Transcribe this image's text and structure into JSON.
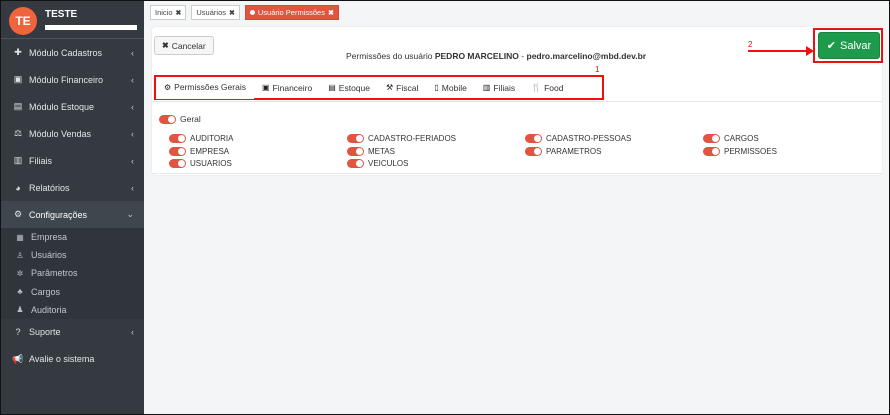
{
  "sidebar": {
    "avatar_initials": "TE",
    "user_name": "TESTE",
    "menu": [
      {
        "icon": "plus-icon",
        "glyph": "✚",
        "label": "Módulo Cadastros",
        "caret": "‹"
      },
      {
        "icon": "money-icon",
        "glyph": "▣",
        "label": "Módulo Financeiro",
        "caret": "‹"
      },
      {
        "icon": "archive-icon",
        "glyph": "▤",
        "label": "Módulo Estoque",
        "caret": "‹"
      },
      {
        "icon": "scale-icon",
        "glyph": "⚖",
        "label": "Módulo Vendas",
        "caret": "‹"
      },
      {
        "icon": "bar-chart-icon",
        "glyph": "▥",
        "label": "Filiais",
        "caret": "‹"
      },
      {
        "icon": "pie-chart-icon",
        "glyph": "◕",
        "label": "Relatórios",
        "caret": "‹"
      },
      {
        "icon": "cogs-icon",
        "glyph": "⚙",
        "label": "Configurações",
        "caret": "⌄"
      }
    ],
    "submenu": [
      {
        "icon": "building-icon",
        "glyph": "▦",
        "label": "Empresa"
      },
      {
        "icon": "user-icon",
        "glyph": "♙",
        "label": "Usuários"
      },
      {
        "icon": "cog-icon",
        "glyph": "✲",
        "label": "Parâmetros"
      },
      {
        "icon": "sitemap-icon",
        "glyph": "♣",
        "label": "Cargos"
      },
      {
        "icon": "user-secret-icon",
        "glyph": "♟",
        "label": "Auditoria"
      }
    ],
    "bottom_menu": [
      {
        "icon": "question-icon",
        "glyph": "?",
        "label": "Suporte",
        "caret": "‹"
      },
      {
        "icon": "bullhorn-icon",
        "glyph": "📢",
        "label": "Avalie o sistema",
        "caret": ""
      }
    ]
  },
  "top_tabs": [
    {
      "label": "Inicio",
      "close": "✖"
    },
    {
      "label": "Usuários",
      "close": "✖"
    },
    {
      "label": "Usuário Permissões",
      "close": "✖"
    }
  ],
  "header": {
    "cancel_label": "Cancelar",
    "cancel_glyph": "✖",
    "title_prefix": "Permissões do usuário",
    "user_name": "PEDRO MARCELINO",
    "separator": "-",
    "user_email": "pedro.marcelino@mbd.dev.br",
    "save_label": "Salvar",
    "save_glyph": "✔",
    "annotation_1": "1",
    "annotation_2": "2"
  },
  "permission_tabs": [
    {
      "icon": "cogs-icon",
      "glyph": "⚙",
      "label": "Permissões Gerais"
    },
    {
      "icon": "money-icon",
      "glyph": "▣",
      "label": "Financeiro"
    },
    {
      "icon": "archive-icon",
      "glyph": "▤",
      "label": "Estoque"
    },
    {
      "icon": "gavel-icon",
      "glyph": "⚒",
      "label": "Fiscal"
    },
    {
      "icon": "mobile-icon",
      "glyph": "▯",
      "label": "Mobile"
    },
    {
      "icon": "bar-chart-icon",
      "glyph": "▥",
      "label": "Filiais"
    },
    {
      "icon": "utensils-icon",
      "glyph": "🍴",
      "label": "Food"
    }
  ],
  "geral_label": "Geral",
  "permissions": [
    "AUDITORIA",
    "CADASTRO-FERIADOS",
    "CADASTRO-PESSOAS",
    "CARGOS",
    "EMPRESA",
    "METAS",
    "PARAMETROS",
    "PERMISSOES",
    "USUARIOS",
    "VEICULOS"
  ],
  "colors": {
    "sidebar_bg": "#343a40",
    "accent_red": "#e05440",
    "save_green": "#1e9a4c",
    "annotation_red": "#ee1111"
  }
}
